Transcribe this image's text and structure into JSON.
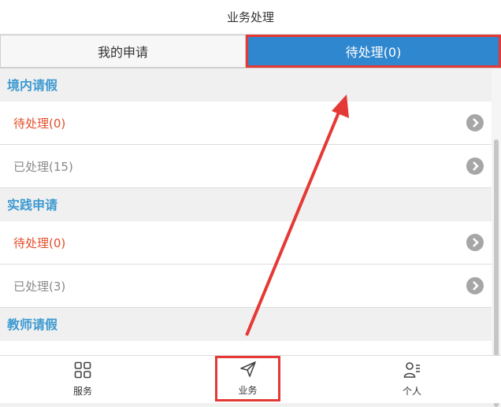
{
  "header": {
    "title": "业务处理"
  },
  "tabs": [
    {
      "label": "我的申请"
    },
    {
      "label": "待处理(0)"
    }
  ],
  "sections": [
    {
      "title": "境内请假",
      "items": [
        {
          "label": "待处理(0)"
        },
        {
          "label": "已处理(15)"
        }
      ]
    },
    {
      "title": "实践申请",
      "items": [
        {
          "label": "待处理(0)"
        },
        {
          "label": "已处理(3)"
        }
      ]
    },
    {
      "title": "教师请假",
      "items": []
    }
  ],
  "bottom_nav": [
    {
      "label": "服务",
      "icon": "grid-icon"
    },
    {
      "label": "业务",
      "icon": "paper-plane-icon"
    },
    {
      "label": "个人",
      "icon": "person-icon"
    }
  ],
  "colors": {
    "accent_blue": "#2f87cf",
    "section_title": "#3d9ad1",
    "pending_text": "#e24d2a",
    "annotation_red": "#e53935"
  }
}
